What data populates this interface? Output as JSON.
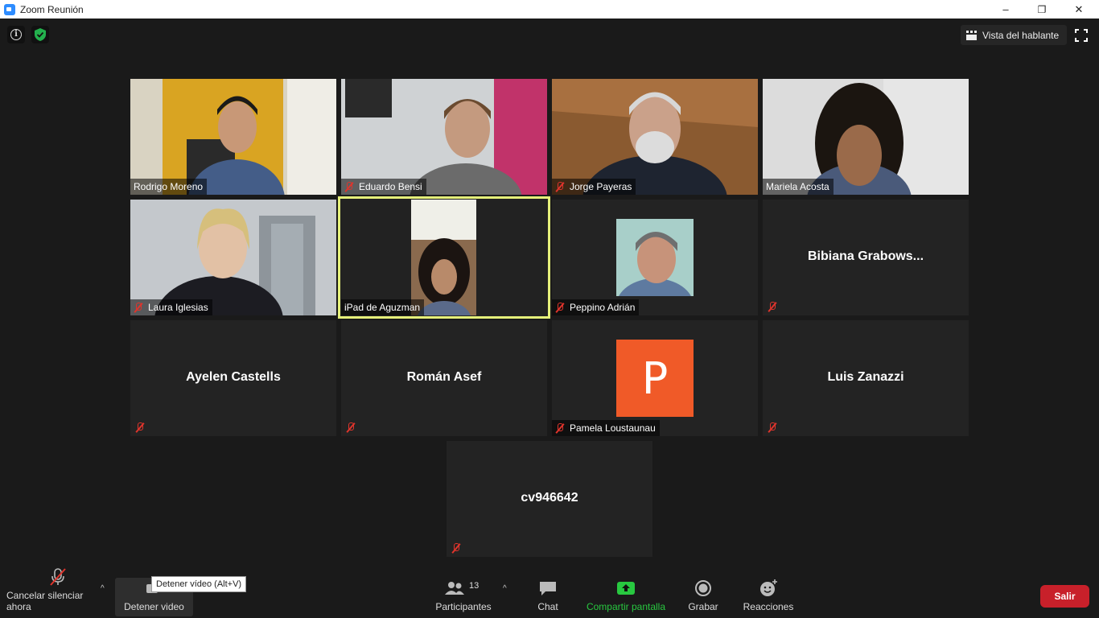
{
  "window": {
    "title": "Zoom Reunión",
    "minimize": "–",
    "restore": "❐",
    "close": "✕"
  },
  "top": {
    "speaker_view_label": "Vista del hablante"
  },
  "participants": [
    {
      "name": "Rodrigo Moreno",
      "muted": false,
      "video": true
    },
    {
      "name": "Eduardo Bensi",
      "muted": true,
      "video": true
    },
    {
      "name": "Jorge Payeras",
      "muted": true,
      "video": true
    },
    {
      "name": "Mariela Acosta",
      "muted": false,
      "video": true
    },
    {
      "name": "Laura Iglesias",
      "muted": true,
      "video": true
    },
    {
      "name": "iPad de Aguzman",
      "muted": false,
      "video": true,
      "active_speaker": true
    },
    {
      "name": "Peppino Adrián",
      "muted": true,
      "video": false,
      "photo": true
    },
    {
      "name": "Bibiana  Grabows...",
      "muted": true,
      "video": false
    },
    {
      "name": "Ayelen Castells",
      "muted": true,
      "video": false
    },
    {
      "name": "Román Asef",
      "muted": true,
      "video": false
    },
    {
      "name": "Pamela Loustaunau",
      "muted": true,
      "video": false,
      "avatar_letter": "P",
      "avatar_color": "#f05a28"
    },
    {
      "name": "Luis Zanazzi",
      "muted": true,
      "video": false
    },
    {
      "name": "cv946642",
      "muted": true,
      "video": false
    }
  ],
  "toolbar": {
    "unmute_label": "Cancelar silenciar ahora",
    "stop_video_label": "Detener video",
    "tooltip": "Detener vídeo (Alt+V)",
    "participants_label": "Participantes",
    "participants_count": "13",
    "chat_label": "Chat",
    "share_label": "Compartir pantalla",
    "record_label": "Grabar",
    "reactions_label": "Reacciones",
    "leave_label": "Salir"
  },
  "colors": {
    "background": "#1a1a1a",
    "tile": "#232323",
    "active_outline": "#e5f07a",
    "share_green": "#28c840",
    "leave_red": "#c8202a",
    "mute_red": "#e0342c"
  }
}
